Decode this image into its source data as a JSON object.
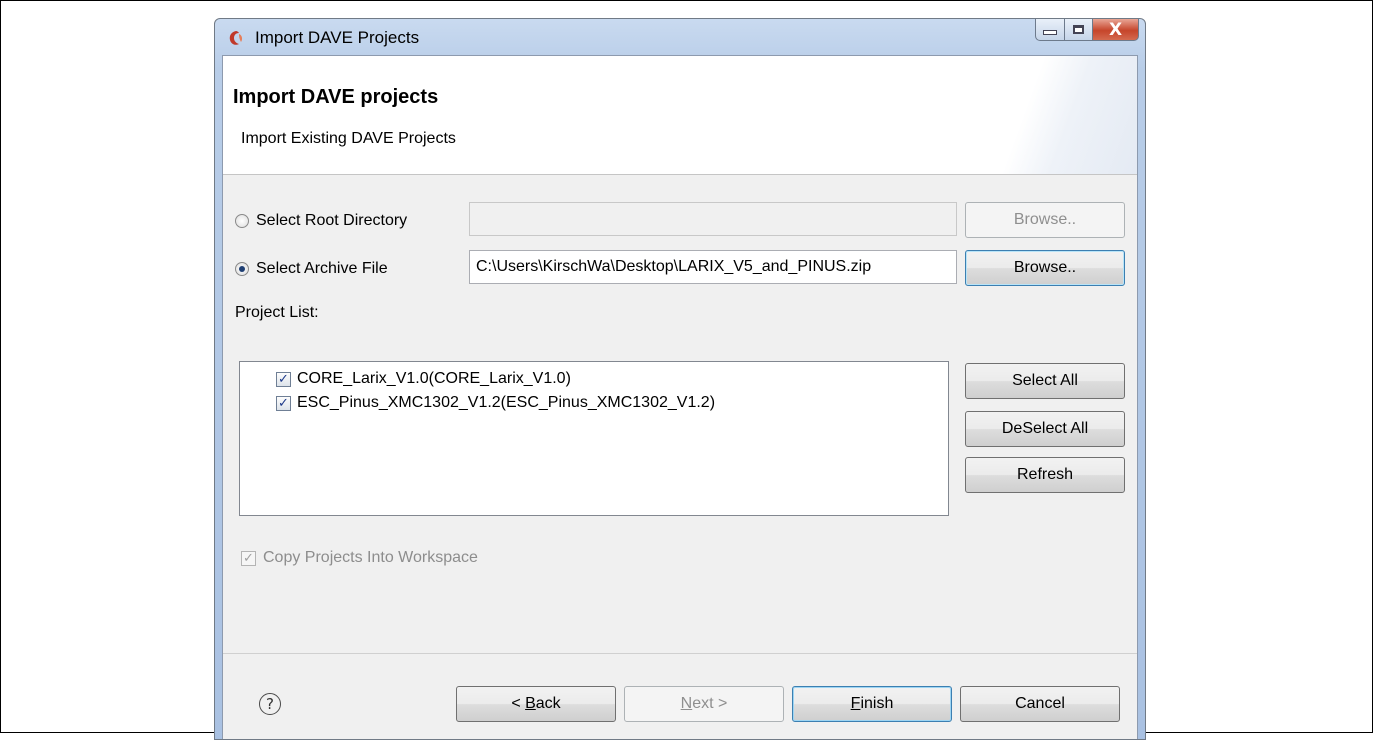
{
  "window": {
    "title": "Import DAVE Projects",
    "close_glyph": "X"
  },
  "header": {
    "title": "Import DAVE projects",
    "description": "Import Existing DAVE Projects"
  },
  "source": {
    "root_directory": {
      "label": "Select Root Directory",
      "selected": false,
      "value": "",
      "browse_label": "Browse..",
      "enabled": false
    },
    "archive_file": {
      "label": "Select Archive File",
      "selected": true,
      "value": "C:\\Users\\KirschWa\\Desktop\\LARIX_V5_and_PINUS.zip",
      "browse_label": "Browse..",
      "enabled": true
    }
  },
  "project_list": {
    "label": "Project List:",
    "items": [
      {
        "label": "CORE_Larix_V1.0(CORE_Larix_V1.0)",
        "checked": true,
        "check_glyph": "✓"
      },
      {
        "label": "ESC_Pinus_XMC1302_V1.2(ESC_Pinus_XMC1302_V1.2)",
        "checked": true,
        "check_glyph": "✓"
      }
    ],
    "select_all_label": "Select All",
    "deselect_all_label": "DeSelect All",
    "refresh_label": "Refresh"
  },
  "copy_into_workspace": {
    "label": "Copy Projects Into Workspace",
    "checked": true,
    "enabled": false,
    "check_glyph": "✓"
  },
  "footer": {
    "help_glyph": "?",
    "back": {
      "prefix": "< ",
      "mnemonic": "B",
      "rest": "ack"
    },
    "next": {
      "mnemonic": "N",
      "rest": "ext >"
    },
    "finish": {
      "mnemonic": "F",
      "rest": "inish"
    },
    "cancel_label": "Cancel"
  },
  "colors": {
    "title_accent": "#c6452b",
    "selection_blue": "#1f3f73"
  },
  "icons": [
    "app-icon",
    "minimize-icon",
    "maximize-icon",
    "close-icon",
    "help-icon",
    "radio-icon",
    "checkbox-icon"
  ]
}
